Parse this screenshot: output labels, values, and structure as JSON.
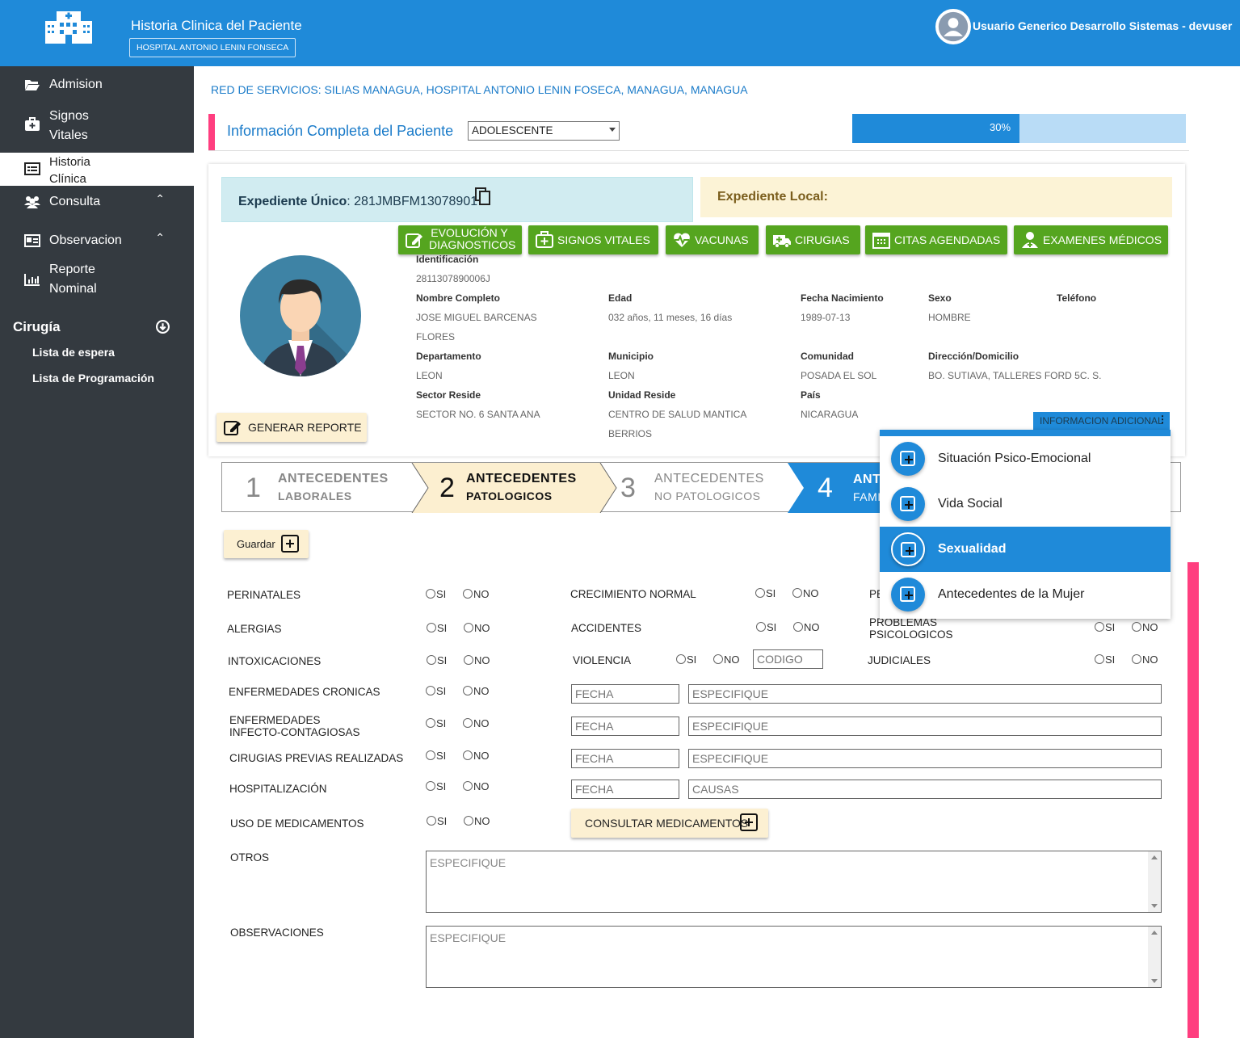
{
  "header": {
    "app_title": "Historia Clinica del Paciente",
    "hospital": "HOSPITAL ANTONIO LENIN FONSECA",
    "user": "Usuario Generico Desarrollo Sistemas - devuser",
    "brand_color": "#1f8ad9"
  },
  "sidebar": {
    "items": [
      {
        "label": "Admision",
        "icon": "folder-open-icon"
      },
      {
        "label": "Signos\nVitales",
        "icon": "medkit-icon"
      },
      {
        "label": "Historia\nClínica",
        "icon": "list-icon",
        "active": true
      },
      {
        "label": "Consulta",
        "icon": "users-icon"
      },
      {
        "label": "Observacion",
        "icon": "id-card-icon"
      },
      {
        "label": "Reporte\nNominal",
        "icon": "bar-chart-icon"
      }
    ],
    "section": "Cirugía",
    "sub_items": [
      "Lista de espera",
      "Lista de Programación"
    ]
  },
  "red_servicios": "RED DE SERVICIOS: SILIAS MANAGUA, HOSPITAL ANTONIO LENIN FOSECA, MANAGUA, MANAGUA",
  "info": {
    "title": "Información Completa del Paciente",
    "select_value": "ADOLESCENTE",
    "progress_label": "30%",
    "progress": 0.5
  },
  "expediente": {
    "unico_label": "Expediente Único",
    "unico_value": ": 281JMBFM13078901",
    "local_label": "Expediente Local:"
  },
  "buttons": {
    "evolucion": "EVOLUCIÓN Y DIAGNOSTICOS",
    "signos": "SIGNOS VITALES",
    "vacunas": "VACUNAS",
    "cirugias": "CIRUGIAS",
    "citas": "CITAS AGENDADAS",
    "examenes": "EXAMENES MÉDICOS",
    "generar": "GENERAR REPORTE",
    "info_adicional": "INFORMACION ADICIONAL",
    "guardar": "Guardar",
    "consultar": "CONSULTAR MEDICAMENTOS"
  },
  "patient": {
    "id_label": "Identificación",
    "id_value": "2811307890006J",
    "name_label": "Nombre Completo",
    "name_value": "JOSE MIGUEL BARCENAS",
    "name_value2": "FLORES",
    "age_label": "Edad",
    "age_value": "032 años, 11 meses, 16 días",
    "birth_label": "Fecha Nacimiento",
    "birth_value": "1989-07-13",
    "sex_label": "Sexo",
    "sex_value": "HOMBRE",
    "phone_label": "Teléfono",
    "dept_label": "Departamento",
    "dept_value": "LEON",
    "muni_label": "Municipio",
    "muni_value": "LEON",
    "com_label": "Comunidad",
    "com_value": "POSADA EL SOL",
    "addr_label": "Dirección/Domicilio",
    "addr_value": "BO. SUTIAVA, TALLERES FORD 5C. S.",
    "sector_label": "Sector Reside",
    "sector_value": "SECTOR NO. 6 SANTA ANA",
    "unidad_label": "Unidad Reside",
    "unidad_value": "CENTRO DE SALUD MANTICA",
    "unidad_value2": "BERRIOS",
    "pais_label": "País",
    "pais_value": "NICARAGUA"
  },
  "dropdown": [
    "Situación Psico-Emocional",
    "Vida Social",
    "Sexualidad",
    "Antecedentes de la Mujer"
  ],
  "steps": [
    {
      "num": "1",
      "t1": "ANTECEDENTES",
      "t2": "LABORALES"
    },
    {
      "num": "2",
      "t1": "ANTECEDENTES",
      "t2": "PATOLOGICOS"
    },
    {
      "num": "3",
      "t1": "ANTECEDENTES",
      "t2": "NO PATOLOGICOS"
    },
    {
      "num": "4",
      "t1": "ANT",
      "t2": "FAMI"
    }
  ],
  "form": {
    "si": "SI",
    "no": "NO",
    "perinatales": "PERINATALES",
    "alergias": "ALERGIAS",
    "intoxicaciones": "INTOXICACIONES",
    "cronicas": "ENFERMEDADES CRONICAS",
    "infecto1": "ENFERMEDADES",
    "infecto2": "INFECTO-CONTAGIOSAS",
    "cirugias": "CIRUGIAS PREVIAS REALIZADAS",
    "hospitalizacion": "HOSPITALIZACIÓN",
    "medicamentos": "USO DE MEDICAMENTOS",
    "otros": "OTROS",
    "observaciones": "OBSERVACIONES",
    "crecimiento": "CRECIMIENTO NORMAL",
    "accidentes": "ACCIDENTES",
    "violencia": "VIOLENCIA",
    "pe": "PE",
    "problemas1": "PROBLEMAS",
    "problemas2": "PSICOLOGICOS",
    "judiciales": "JUDICIALES",
    "ph_codigo": "CODIGO",
    "ph_fecha": "FECHA",
    "ph_especifique": "ESPECIFIQUE",
    "ph_causas": "CAUSAS"
  }
}
